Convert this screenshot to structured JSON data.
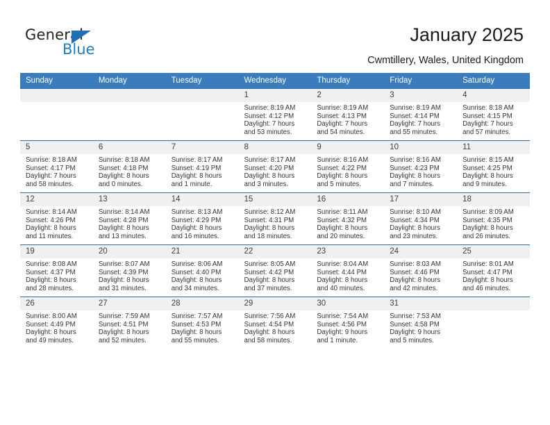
{
  "brand": {
    "name_top": "General",
    "name_bottom": "Blue",
    "triangle_icon": "triangle-icon",
    "accent_color": "#1f7ec0",
    "header_color": "#3a7cbe"
  },
  "header": {
    "title": "January 2025",
    "subtitle": "Cwmtillery, Wales, United Kingdom"
  },
  "calendar": {
    "weekdays": [
      "Sunday",
      "Monday",
      "Tuesday",
      "Wednesday",
      "Thursday",
      "Friday",
      "Saturday"
    ],
    "weeks": [
      [
        {
          "day": "",
          "lines": []
        },
        {
          "day": "",
          "lines": []
        },
        {
          "day": "",
          "lines": []
        },
        {
          "day": "1",
          "lines": [
            "Sunrise: 8:19 AM",
            "Sunset: 4:12 PM",
            "Daylight: 7 hours",
            "and 53 minutes."
          ]
        },
        {
          "day": "2",
          "lines": [
            "Sunrise: 8:19 AM",
            "Sunset: 4:13 PM",
            "Daylight: 7 hours",
            "and 54 minutes."
          ]
        },
        {
          "day": "3",
          "lines": [
            "Sunrise: 8:19 AM",
            "Sunset: 4:14 PM",
            "Daylight: 7 hours",
            "and 55 minutes."
          ]
        },
        {
          "day": "4",
          "lines": [
            "Sunrise: 8:18 AM",
            "Sunset: 4:15 PM",
            "Daylight: 7 hours",
            "and 57 minutes."
          ]
        }
      ],
      [
        {
          "day": "5",
          "lines": [
            "Sunrise: 8:18 AM",
            "Sunset: 4:17 PM",
            "Daylight: 7 hours",
            "and 58 minutes."
          ]
        },
        {
          "day": "6",
          "lines": [
            "Sunrise: 8:18 AM",
            "Sunset: 4:18 PM",
            "Daylight: 8 hours",
            "and 0 minutes."
          ]
        },
        {
          "day": "7",
          "lines": [
            "Sunrise: 8:17 AM",
            "Sunset: 4:19 PM",
            "Daylight: 8 hours",
            "and 1 minute."
          ]
        },
        {
          "day": "8",
          "lines": [
            "Sunrise: 8:17 AM",
            "Sunset: 4:20 PM",
            "Daylight: 8 hours",
            "and 3 minutes."
          ]
        },
        {
          "day": "9",
          "lines": [
            "Sunrise: 8:16 AM",
            "Sunset: 4:22 PM",
            "Daylight: 8 hours",
            "and 5 minutes."
          ]
        },
        {
          "day": "10",
          "lines": [
            "Sunrise: 8:16 AM",
            "Sunset: 4:23 PM",
            "Daylight: 8 hours",
            "and 7 minutes."
          ]
        },
        {
          "day": "11",
          "lines": [
            "Sunrise: 8:15 AM",
            "Sunset: 4:25 PM",
            "Daylight: 8 hours",
            "and 9 minutes."
          ]
        }
      ],
      [
        {
          "day": "12",
          "lines": [
            "Sunrise: 8:14 AM",
            "Sunset: 4:26 PM",
            "Daylight: 8 hours",
            "and 11 minutes."
          ]
        },
        {
          "day": "13",
          "lines": [
            "Sunrise: 8:14 AM",
            "Sunset: 4:28 PM",
            "Daylight: 8 hours",
            "and 13 minutes."
          ]
        },
        {
          "day": "14",
          "lines": [
            "Sunrise: 8:13 AM",
            "Sunset: 4:29 PM",
            "Daylight: 8 hours",
            "and 16 minutes."
          ]
        },
        {
          "day": "15",
          "lines": [
            "Sunrise: 8:12 AM",
            "Sunset: 4:31 PM",
            "Daylight: 8 hours",
            "and 18 minutes."
          ]
        },
        {
          "day": "16",
          "lines": [
            "Sunrise: 8:11 AM",
            "Sunset: 4:32 PM",
            "Daylight: 8 hours",
            "and 20 minutes."
          ]
        },
        {
          "day": "17",
          "lines": [
            "Sunrise: 8:10 AM",
            "Sunset: 4:34 PM",
            "Daylight: 8 hours",
            "and 23 minutes."
          ]
        },
        {
          "day": "18",
          "lines": [
            "Sunrise: 8:09 AM",
            "Sunset: 4:35 PM",
            "Daylight: 8 hours",
            "and 26 minutes."
          ]
        }
      ],
      [
        {
          "day": "19",
          "lines": [
            "Sunrise: 8:08 AM",
            "Sunset: 4:37 PM",
            "Daylight: 8 hours",
            "and 28 minutes."
          ]
        },
        {
          "day": "20",
          "lines": [
            "Sunrise: 8:07 AM",
            "Sunset: 4:39 PM",
            "Daylight: 8 hours",
            "and 31 minutes."
          ]
        },
        {
          "day": "21",
          "lines": [
            "Sunrise: 8:06 AM",
            "Sunset: 4:40 PM",
            "Daylight: 8 hours",
            "and 34 minutes."
          ]
        },
        {
          "day": "22",
          "lines": [
            "Sunrise: 8:05 AM",
            "Sunset: 4:42 PM",
            "Daylight: 8 hours",
            "and 37 minutes."
          ]
        },
        {
          "day": "23",
          "lines": [
            "Sunrise: 8:04 AM",
            "Sunset: 4:44 PM",
            "Daylight: 8 hours",
            "and 40 minutes."
          ]
        },
        {
          "day": "24",
          "lines": [
            "Sunrise: 8:03 AM",
            "Sunset: 4:46 PM",
            "Daylight: 8 hours",
            "and 42 minutes."
          ]
        },
        {
          "day": "25",
          "lines": [
            "Sunrise: 8:01 AM",
            "Sunset: 4:47 PM",
            "Daylight: 8 hours",
            "and 46 minutes."
          ]
        }
      ],
      [
        {
          "day": "26",
          "lines": [
            "Sunrise: 8:00 AM",
            "Sunset: 4:49 PM",
            "Daylight: 8 hours",
            "and 49 minutes."
          ]
        },
        {
          "day": "27",
          "lines": [
            "Sunrise: 7:59 AM",
            "Sunset: 4:51 PM",
            "Daylight: 8 hours",
            "and 52 minutes."
          ]
        },
        {
          "day": "28",
          "lines": [
            "Sunrise: 7:57 AM",
            "Sunset: 4:53 PM",
            "Daylight: 8 hours",
            "and 55 minutes."
          ]
        },
        {
          "day": "29",
          "lines": [
            "Sunrise: 7:56 AM",
            "Sunset: 4:54 PM",
            "Daylight: 8 hours",
            "and 58 minutes."
          ]
        },
        {
          "day": "30",
          "lines": [
            "Sunrise: 7:54 AM",
            "Sunset: 4:56 PM",
            "Daylight: 9 hours",
            "and 1 minute."
          ]
        },
        {
          "day": "31",
          "lines": [
            "Sunrise: 7:53 AM",
            "Sunset: 4:58 PM",
            "Daylight: 9 hours",
            "and 5 minutes."
          ]
        },
        {
          "day": "",
          "lines": []
        }
      ]
    ]
  }
}
